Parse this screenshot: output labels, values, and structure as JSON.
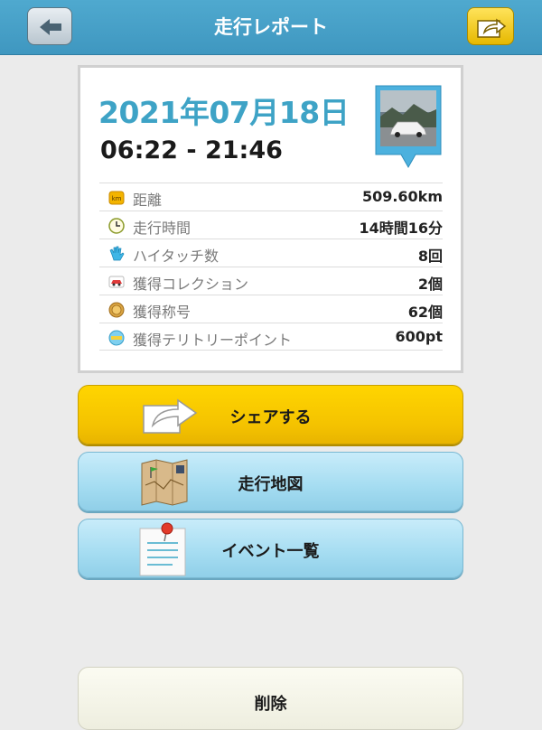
{
  "header": {
    "title": "走行レポート"
  },
  "report": {
    "date": "2021年07月18日",
    "time_range": "06:22 - 21:46",
    "stats": [
      {
        "icon": "km-badge-icon",
        "label": "距離",
        "value": "509.60km"
      },
      {
        "icon": "clock-icon",
        "label": "走行時間",
        "value": "14時間16分"
      },
      {
        "icon": "high-five-hand-icon",
        "label": "ハイタッチ数",
        "value": "8回"
      },
      {
        "icon": "car-collection-icon",
        "label": "獲得コレクション",
        "value": "2個"
      },
      {
        "icon": "title-medal-icon",
        "label": "獲得称号",
        "value": "62個"
      },
      {
        "icon": "territory-point-icon",
        "label": "獲得テリトリーポイント",
        "value": "600pt"
      }
    ]
  },
  "actions": {
    "share_label": "シェアする",
    "map_label": "走行地図",
    "events_label": "イベント一覧",
    "delete_label": "削除"
  },
  "colors": {
    "header": "#47a0c8",
    "date_text": "#3ea3c6",
    "share_button": "#f4c200",
    "blue_button": "#a4dcf1"
  }
}
